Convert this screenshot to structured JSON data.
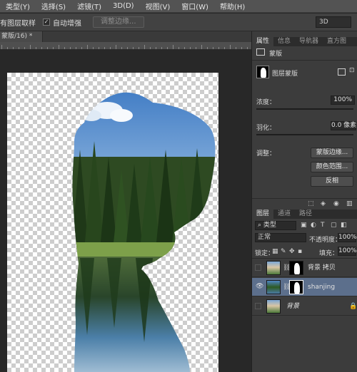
{
  "menu": {
    "items": [
      "类型(Y)",
      "选择(S)",
      "滤镜(T)",
      "3D(D)",
      "视图(V)",
      "窗口(W)",
      "帮助(H)"
    ]
  },
  "options": {
    "sample_all_layers_label": "有图层取样",
    "auto_enhance_label": "自动增强",
    "auto_enhance_checked": true,
    "refine_edge_button": "调整边缘...",
    "workspace_value": "3D"
  },
  "document": {
    "tab_label": "蒙版/16) *"
  },
  "panel": {
    "props_tabs": [
      "属性",
      "信息",
      "导航器",
      "直方图"
    ],
    "mask_title": "蒙版",
    "layer_mask_label": "图层蒙版",
    "density_label": "浓度：",
    "density_value": "100%",
    "feather_label": "羽化：",
    "feather_value": "0.0 像素",
    "adjust_label": "调整：",
    "mask_edge_button": "蒙版边缘...",
    "color_range_button": "颜色范围...",
    "invert_button": "反相",
    "layers_tabs": [
      "图层",
      "通道",
      "路径"
    ],
    "filter_kind": "类型",
    "blend_mode": "正常",
    "opacity_label": "不透明度：",
    "opacity_value": "100%",
    "lock_label": "锁定：",
    "fill_label": "填充：",
    "fill_value": "100%",
    "layers": [
      {
        "name": "背景 拷贝",
        "visible": false,
        "selected": false
      },
      {
        "name": "shanjing",
        "visible": true,
        "selected": true
      },
      {
        "name": "背景",
        "visible": false,
        "selected": false
      }
    ]
  },
  "colors": {
    "accent_selected": "#5c6f8c",
    "sky": "#5b8fc9",
    "forest": "#2e4a22"
  }
}
